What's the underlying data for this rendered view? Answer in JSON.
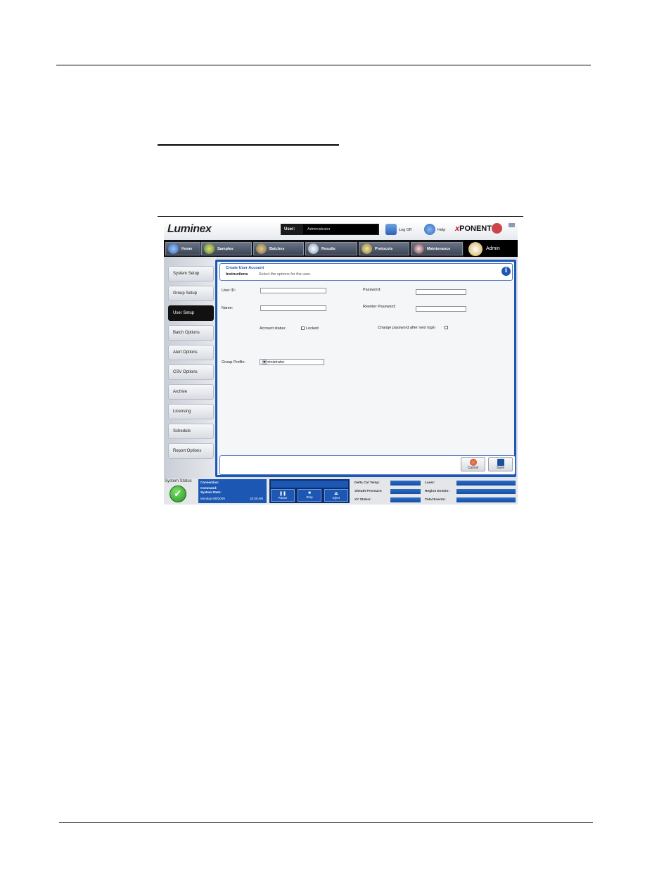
{
  "app": {
    "brand": "Luminex",
    "product": {
      "prefix": "x",
      "name": "PONENT"
    },
    "user": {
      "label": "User:",
      "value": "Administrator"
    },
    "header_buttons": [
      {
        "label": "Log Off",
        "icon": "log-off-icon"
      },
      {
        "label": "Help",
        "icon": "help-icon"
      }
    ],
    "tabs": [
      {
        "label": "Home",
        "icon": "home-icon"
      },
      {
        "label": "Samples",
        "icon": "samples-icon"
      },
      {
        "label": "Batches",
        "icon": "batches-icon"
      },
      {
        "label": "Results",
        "icon": "results-icon"
      },
      {
        "label": "Protocols",
        "icon": "protocols-icon"
      },
      {
        "label": "Maintenance",
        "icon": "maintenance-icon"
      },
      {
        "label": "Admin",
        "icon": "admin-icon",
        "active": true
      }
    ],
    "sidenav": [
      "System Setup",
      "Group Setup",
      "User Setup",
      "Batch Options",
      "Alert Options",
      "CSV Options",
      "Archive",
      "Licensing",
      "Schedule",
      "Report Options"
    ],
    "active_sidenav": "User Setup",
    "panel": {
      "title": "Create User Account",
      "instructions_label": "Instructions",
      "instructions_text": "Select the options for the user.",
      "fields": {
        "user_id_label": "User ID:",
        "name_label": "Name:",
        "password_label": "Password:",
        "reenter_password_label": "Reenter Password:",
        "account_status_label": "Account status:",
        "locked_label": "Locked",
        "change_password_label": "Change password after next login",
        "group_profile_label": "Group Profile:",
        "group_profile_value": "Administrator"
      },
      "buttons": {
        "cancel": "Cancel",
        "save": "Save"
      }
    },
    "status_bar": {
      "label": "System Status",
      "connection": "Connection:",
      "command": "Command:",
      "system_state": "System State:",
      "date": "Monday 6/8/2009",
      "time": "10:30 AM",
      "controls": [
        "Pause",
        "Stop",
        "Eject"
      ],
      "meters": [
        "Delta Cal Temp:",
        "Sheath Pressure:",
        "XY Status:",
        "Laser:",
        "Region Events:",
        "Total Events:"
      ]
    },
    "colors": {
      "accent": "#1c57b4",
      "active_nav": "#111111",
      "ok": "#23931c",
      "xponent_red": "#c0121d"
    }
  }
}
